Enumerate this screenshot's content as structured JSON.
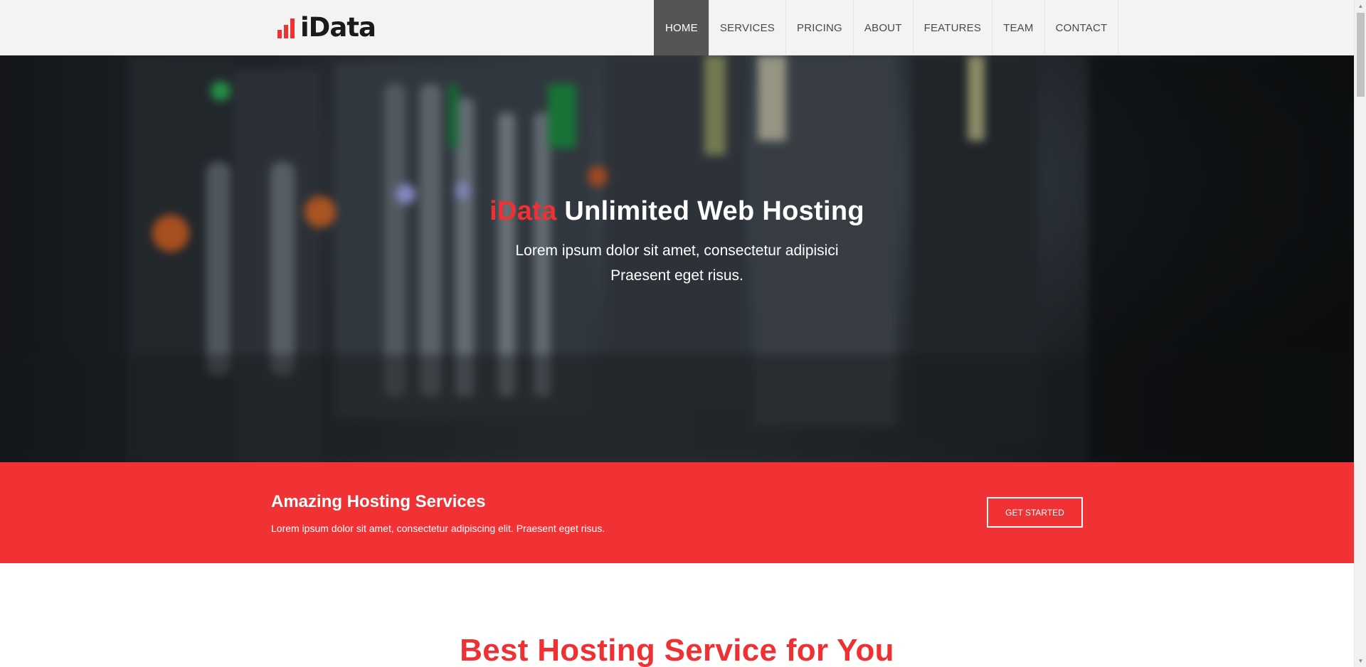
{
  "header": {
    "logo_text": "iData",
    "nav": [
      {
        "label": "HOME",
        "active": true
      },
      {
        "label": "SERVICES",
        "active": false
      },
      {
        "label": "PRICING",
        "active": false
      },
      {
        "label": "ABOUT",
        "active": false
      },
      {
        "label": "FEATURES",
        "active": false
      },
      {
        "label": "TEAM",
        "active": false
      },
      {
        "label": "CONTACT",
        "active": false
      }
    ]
  },
  "hero": {
    "brand": "iData",
    "title_rest": "Unlimited Web Hosting",
    "subtitle_line1": "Lorem ipsum dolor sit amet, consectetur adipisici",
    "subtitle_line2": "Praesent eget risus."
  },
  "band": {
    "title": "Amazing Hosting Services",
    "text": "Lorem ipsum dolor sit amet, consectetur adipiscing elit. Praesent eget risus.",
    "button_label": "GET STARTED"
  },
  "section": {
    "title": "Best Hosting Service for You"
  },
  "colors": {
    "accent": "#ef3133",
    "band_background": "#f03234",
    "header_background": "#f3f3f3",
    "nav_active_background": "#555555"
  },
  "icons": {
    "logo": "bar-chart-icon"
  }
}
